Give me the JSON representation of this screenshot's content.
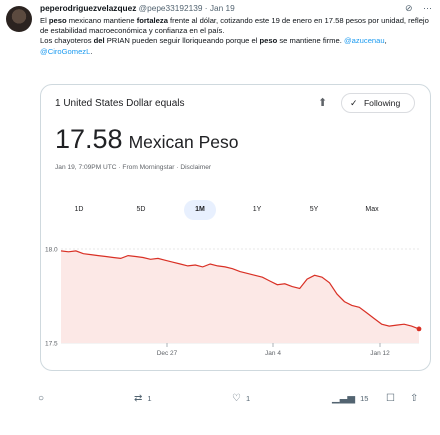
{
  "tweet": {
    "display_name": "peperodriguezvelazquez",
    "handle": "@pepe33192139",
    "separator": "·",
    "date": "Jan 19",
    "paragraph1_segments": [
      {
        "text": "El ",
        "style": "normal"
      },
      {
        "text": "peso",
        "style": "bold"
      },
      {
        "text": " mexicano mantiene ",
        "style": "normal"
      },
      {
        "text": "fortaleza",
        "style": "bold"
      },
      {
        "text": " frente al dólar, cotizando este 19 de enero en 17.58 pesos por unidad, reflejo de estabilidad macroeconómica y confianza en el país.",
        "style": "normal"
      }
    ],
    "paragraph2_segments": [
      {
        "text": "Los chayoteros ",
        "style": "normal"
      },
      {
        "text": "del",
        "style": "bold"
      },
      {
        "text": " PRIAN pueden seguir lloriqueando porque el ",
        "style": "normal"
      },
      {
        "text": "peso",
        "style": "bold"
      },
      {
        "text": " se mantiene firme. ",
        "style": "normal"
      },
      {
        "text": "@azucenau",
        "style": "link"
      },
      {
        "text": ", ",
        "style": "normal"
      },
      {
        "text": "@CiroGomezL",
        "style": "link"
      },
      {
        "text": ".",
        "style": "normal"
      }
    ]
  },
  "card": {
    "equals_text": "1 United States Dollar equals",
    "follow_label": "Following",
    "rate_value": "17.58",
    "rate_currency": "Mexican Peso",
    "timestamp": "Jan 19, 7:09PM UTC · From Morningstar · Disclaimer",
    "ranges": [
      "1D",
      "5D",
      "1M",
      "1Y",
      "5Y",
      "Max"
    ],
    "active_range": "1M"
  },
  "chart_data": {
    "type": "area",
    "x_ticks": [
      "Dec 27",
      "Jan 4",
      "Jan 12"
    ],
    "y_ticks": [
      {
        "label": "18.0",
        "value": 18.0
      },
      {
        "label": "17.5",
        "value": 17.5
      }
    ],
    "ylim": [
      17.5,
      18.0
    ],
    "line_color": "#d93025",
    "fill_color": "#fce8e6",
    "grid": true,
    "series": [
      {
        "values": [
          17.99,
          17.985,
          17.99,
          17.975,
          17.97,
          17.965,
          17.96,
          17.955,
          17.95,
          17.965,
          17.96,
          17.955,
          17.945,
          17.95,
          17.94,
          17.93,
          17.92,
          17.91,
          17.915,
          17.905,
          17.92,
          17.91,
          17.905,
          17.895,
          17.88,
          17.87,
          17.86,
          17.85,
          17.83,
          17.81,
          17.815,
          17.8,
          17.79,
          17.84,
          17.86,
          17.85,
          17.82,
          17.76,
          17.72,
          17.7,
          17.69,
          17.66,
          17.63,
          17.6,
          17.59,
          17.595,
          17.6,
          17.59,
          17.575
        ]
      }
    ]
  },
  "actions": {
    "replies": "",
    "retweets": "1",
    "likes": "1",
    "views": "15"
  }
}
